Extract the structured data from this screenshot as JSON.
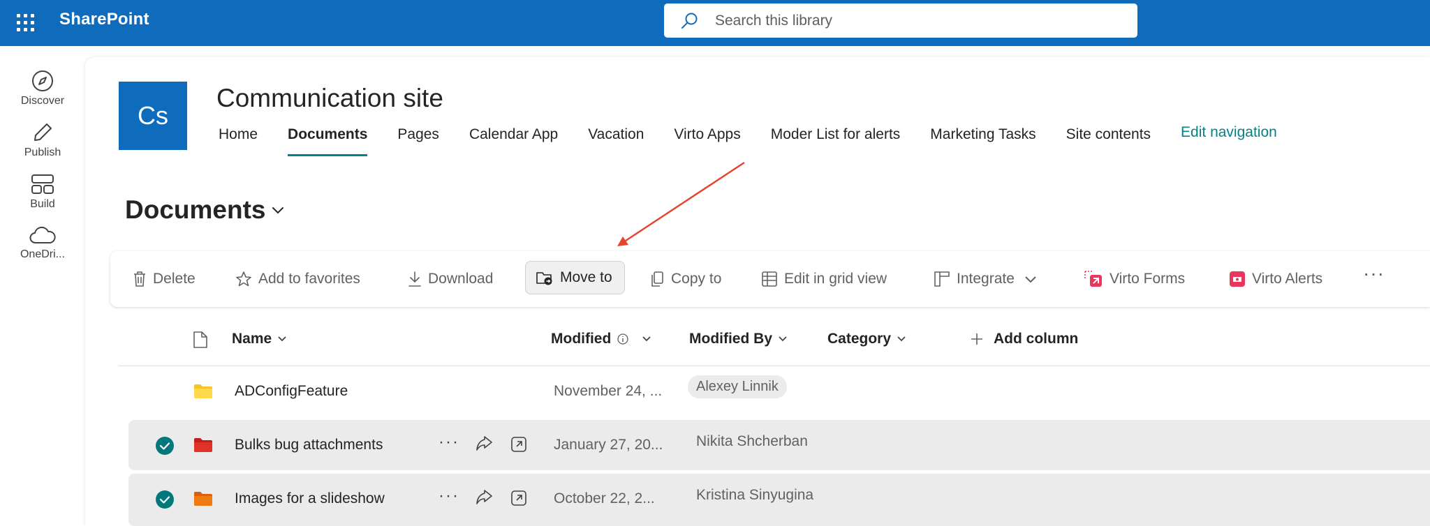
{
  "suite": {
    "brand": "SharePoint",
    "search_placeholder": "Search this library"
  },
  "appbar": {
    "items": [
      {
        "label": "Discover",
        "icon": "compass-icon"
      },
      {
        "label": "Publish",
        "icon": "pen-icon"
      },
      {
        "label": "Build",
        "icon": "layout-icon"
      },
      {
        "label": "OneDri...",
        "icon": "cloud-icon"
      }
    ]
  },
  "site": {
    "logo_text": "Cs",
    "title": "Communication site",
    "nav": [
      "Home",
      "Documents",
      "Pages",
      "Calendar App",
      "Vacation",
      "Virto Apps",
      "Moder List for alerts",
      "Marketing Tasks",
      "Site contents"
    ],
    "active_nav": "Documents",
    "edit_nav": "Edit navigation"
  },
  "library": {
    "title": "Documents"
  },
  "commands": {
    "delete": "Delete",
    "favorites": "Add to favorites",
    "download": "Download",
    "move": "Move to",
    "copy": "Copy to",
    "grid": "Edit in grid view",
    "integrate": "Integrate",
    "virto_forms": "Virto Forms",
    "virto_alerts": "Virto Alerts",
    "more": "···"
  },
  "columns": {
    "name": "Name",
    "modified": "Modified",
    "modified_by": "Modified By",
    "category": "Category",
    "add_column": "Add column"
  },
  "rows": [
    {
      "name": "ADConfigFeature",
      "modified": "November 24, ...",
      "modified_by": "Alexey Linnik",
      "selected": false,
      "folder_color": "#f7c325"
    },
    {
      "name": "Bulks bug attachments",
      "modified": "January 27, 20...",
      "modified_by": "Nikita Shcherban",
      "selected": true,
      "folder_color": "#e0312a"
    },
    {
      "name": "Images for a slideshow",
      "modified": "October 22, 2...",
      "modified_by": "Kristina Sinyugina",
      "selected": true,
      "folder_color": "#f07a12"
    }
  ],
  "row_actions": {
    "more": "···"
  },
  "colors": {
    "brand_blue": "#0f6cbd",
    "accent_teal": "#038387",
    "annotation_arrow": "#e8432e"
  }
}
